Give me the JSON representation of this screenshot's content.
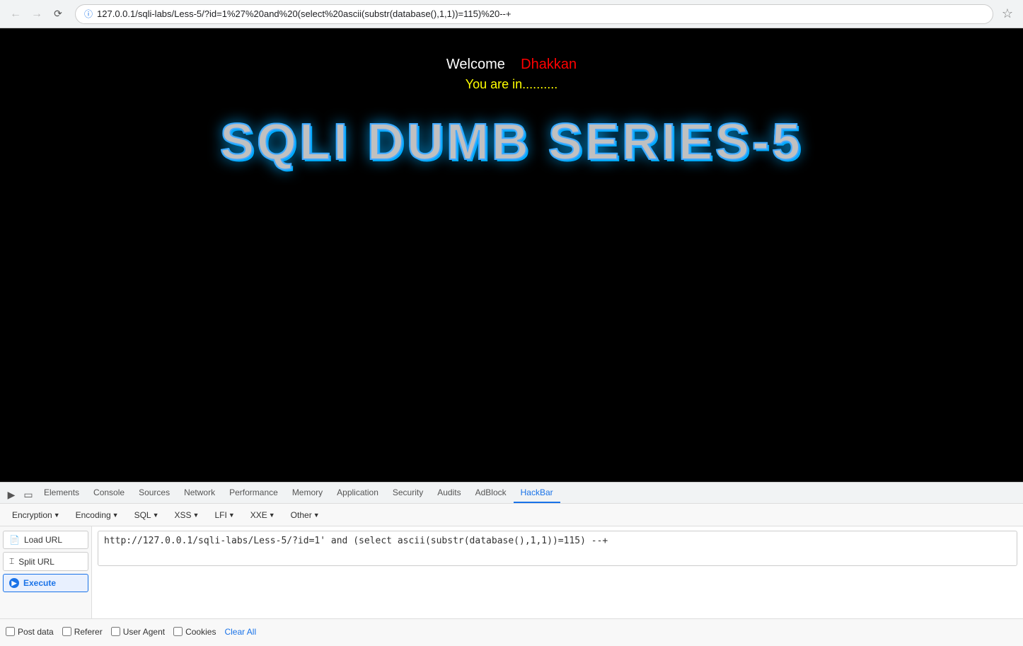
{
  "browser": {
    "url": "127.0.0.1/sqli-labs/Less-5/?id=1%27%20and%20(select%20ascii(substr(database(),1,1))=115)%20--+",
    "back_disabled": true,
    "forward_disabled": true
  },
  "page": {
    "welcome_label": "Welcome",
    "username": "Dhakkan",
    "you_are_in": "You are in.........."
  },
  "sqli_title": "SQLI DUMB SERIES-5",
  "devtools": {
    "tabs": [
      {
        "label": "Elements"
      },
      {
        "label": "Console"
      },
      {
        "label": "Sources"
      },
      {
        "label": "Network"
      },
      {
        "label": "Performance"
      },
      {
        "label": "Memory"
      },
      {
        "label": "Application"
      },
      {
        "label": "Security"
      },
      {
        "label": "Audits"
      },
      {
        "label": "AdBlock"
      },
      {
        "label": "HackBar",
        "active": true
      }
    ]
  },
  "hackbar": {
    "menus": [
      {
        "label": "Encryption",
        "has_dropdown": true
      },
      {
        "label": "Encoding",
        "has_dropdown": true
      },
      {
        "label": "SQL",
        "has_dropdown": true
      },
      {
        "label": "XSS",
        "has_dropdown": true
      },
      {
        "label": "LFI",
        "has_dropdown": true
      },
      {
        "label": "XXE",
        "has_dropdown": true
      },
      {
        "label": "Other",
        "has_dropdown": true
      }
    ],
    "load_url_label": "Load URL",
    "split_url_label": "Split URL",
    "execute_label": "Execute",
    "url_value": "http://127.0.0.1/sqli-labs/Less-5/?id=1' and (select ascii(substr(database(),1,1))=115) --+",
    "checkboxes": [
      {
        "label": "Post data",
        "checked": false
      },
      {
        "label": "Referer",
        "checked": false
      },
      {
        "label": "User Agent",
        "checked": false
      },
      {
        "label": "Cookies",
        "checked": false
      }
    ],
    "clear_all_label": "Clear All"
  }
}
